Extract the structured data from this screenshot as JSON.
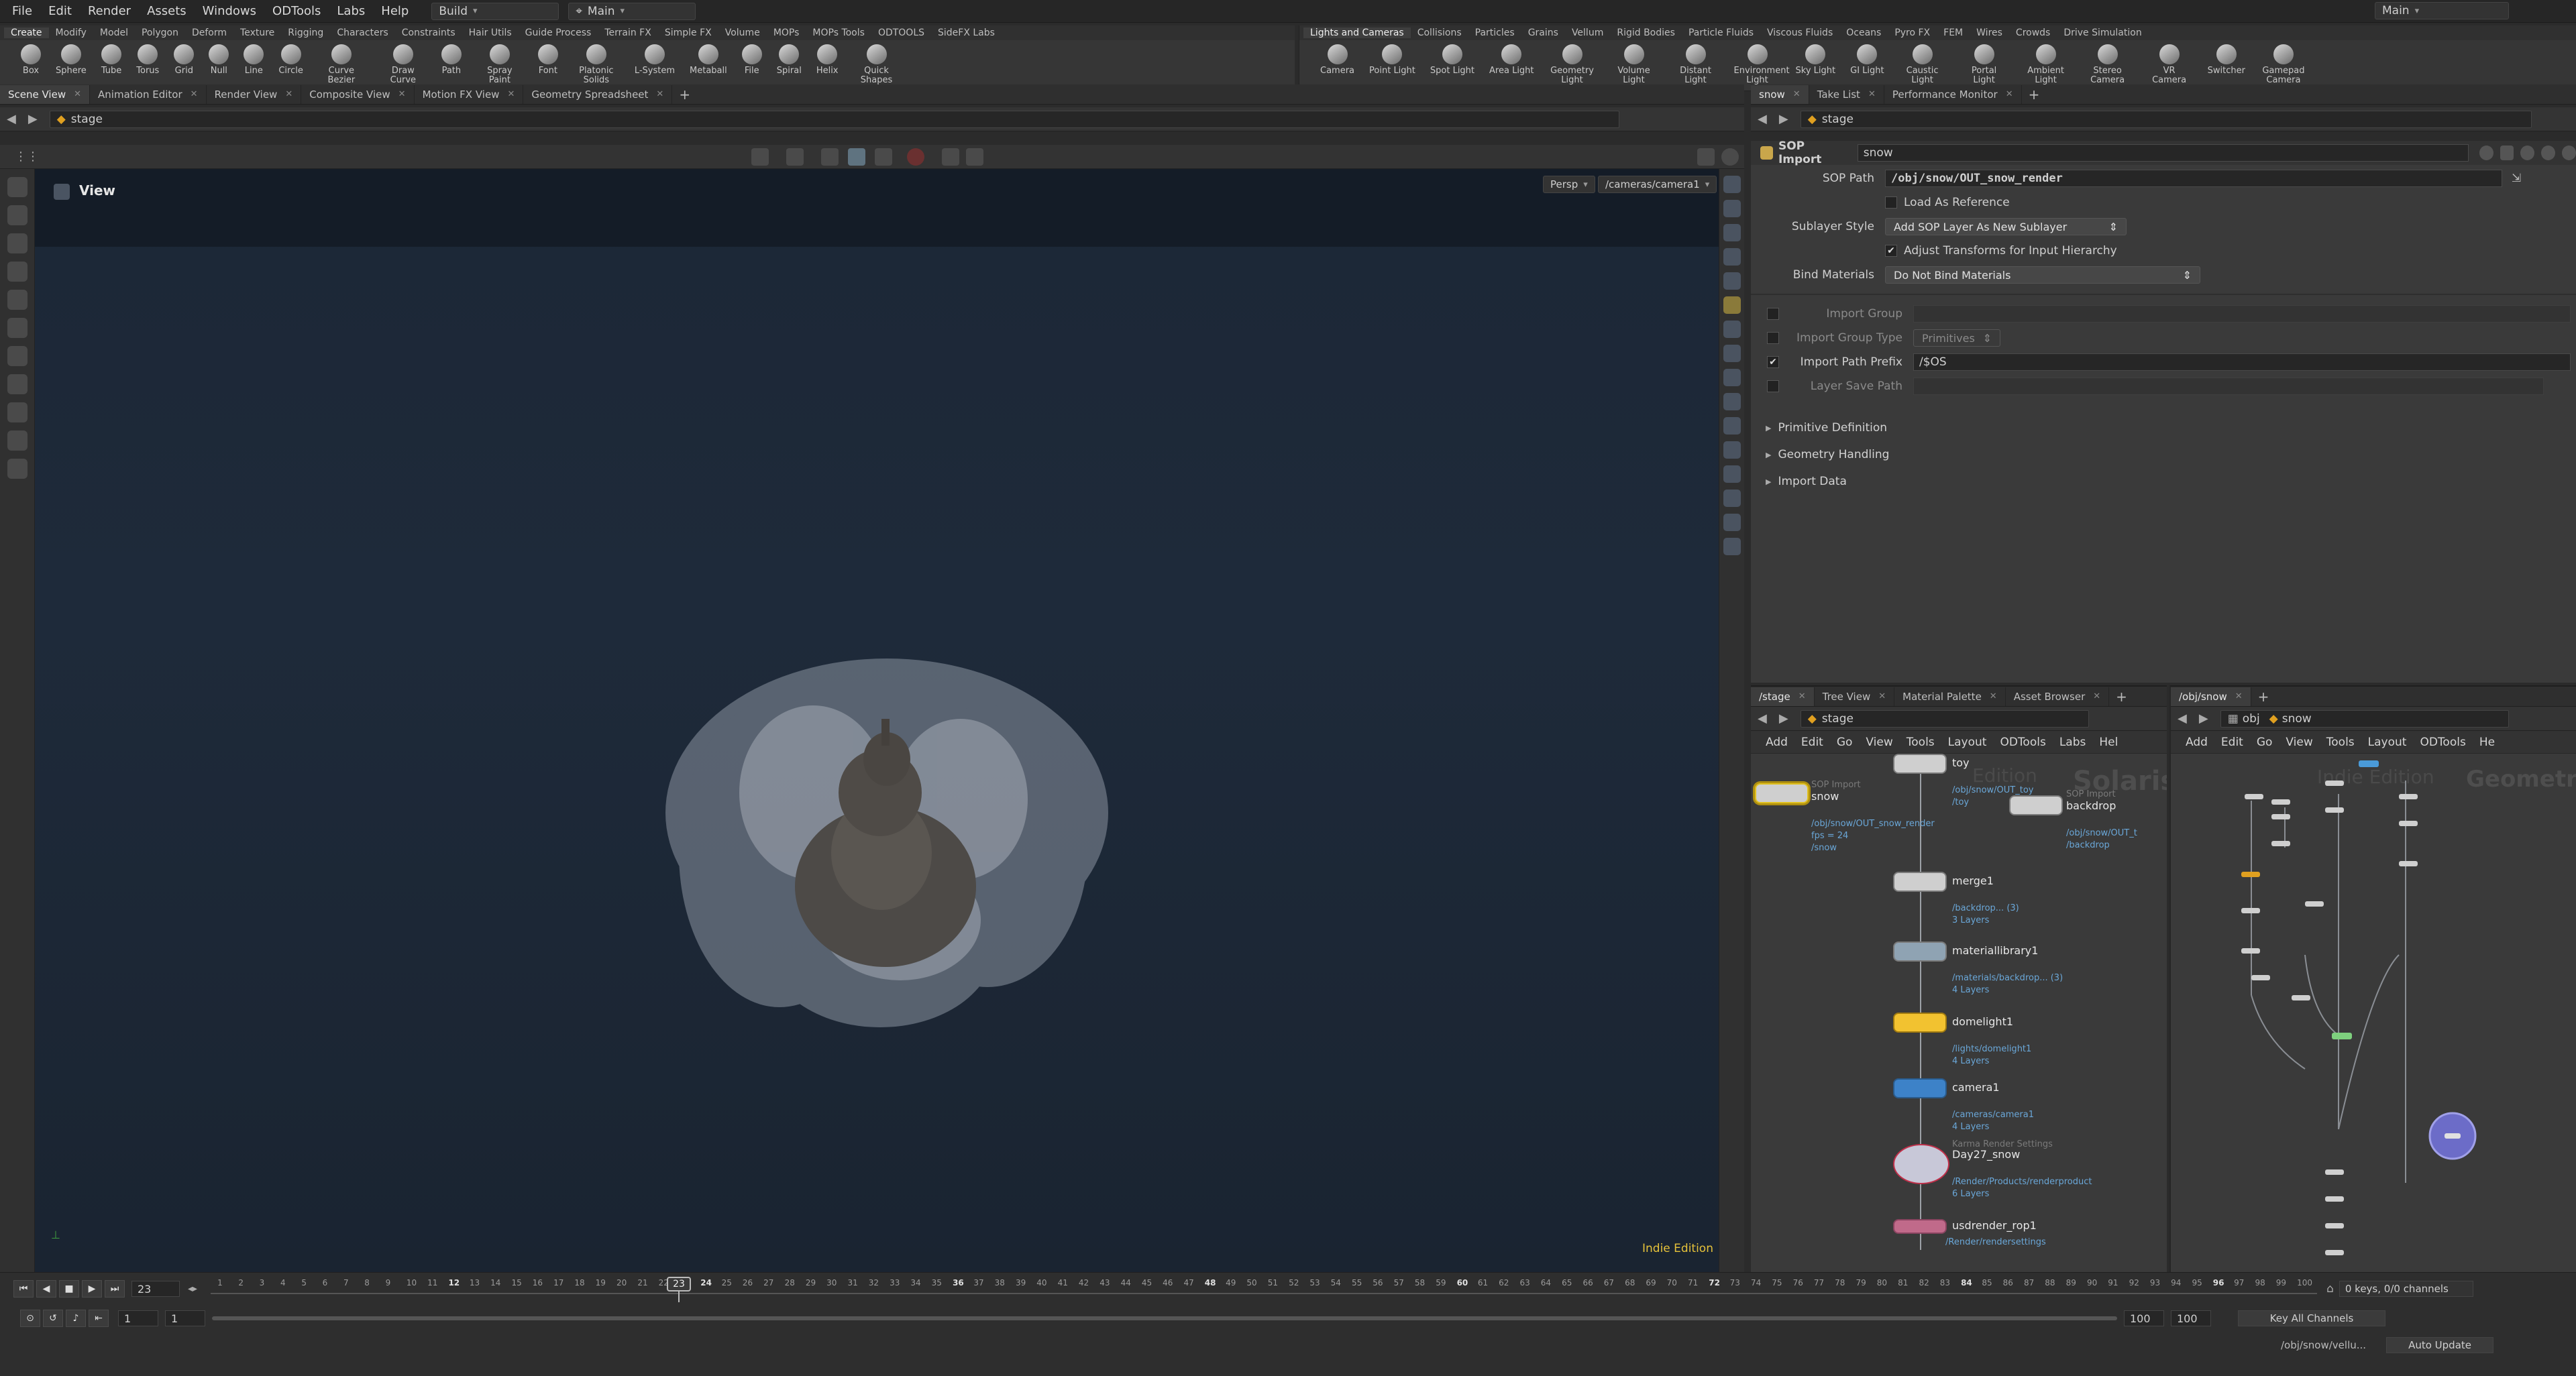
{
  "menubar": {
    "items": [
      "File",
      "Edit",
      "Render",
      "Assets",
      "Windows",
      "ODTools",
      "Labs",
      "Help"
    ],
    "desktop_dropdown": "Build",
    "context_dropdown": "Main",
    "right_dropdown": "Main"
  },
  "shelf_left": {
    "tabs": [
      "Create",
      "Modify",
      "Model",
      "Polygon",
      "Deform",
      "Texture",
      "Rigging",
      "Characters",
      "Constraints",
      "Hair Utils",
      "Guide Process",
      "Terrain FX",
      "Simple FX",
      "Volume",
      "MOPs",
      "MOPs Tools",
      "ODTOOLS",
      "SideFX Labs"
    ],
    "active_tab": "Create",
    "tools": [
      {
        "label": "Box",
        "icon": "box-icon"
      },
      {
        "label": "Sphere",
        "icon": "sphere-icon"
      },
      {
        "label": "Tube",
        "icon": "tube-icon"
      },
      {
        "label": "Torus",
        "icon": "torus-icon"
      },
      {
        "label": "Grid",
        "icon": "grid-icon"
      },
      {
        "label": "Null",
        "icon": "null-icon"
      },
      {
        "label": "Line",
        "icon": "line-icon"
      },
      {
        "label": "Circle",
        "icon": "circle-icon"
      },
      {
        "label": "Curve Bezier",
        "icon": "curve-bezier-icon"
      },
      {
        "label": "Draw Curve",
        "icon": "draw-curve-icon"
      },
      {
        "label": "Path",
        "icon": "path-icon"
      },
      {
        "label": "Spray Paint",
        "icon": "spray-paint-icon"
      },
      {
        "label": "Font",
        "icon": "font-icon"
      },
      {
        "label": "Platonic Solids",
        "icon": "platonic-solids-icon"
      },
      {
        "label": "L-System",
        "icon": "l-system-icon"
      },
      {
        "label": "Metaball",
        "icon": "metaball-icon"
      },
      {
        "label": "File",
        "icon": "file-icon"
      },
      {
        "label": "Spiral",
        "icon": "spiral-icon"
      },
      {
        "label": "Helix",
        "icon": "helix-icon"
      },
      {
        "label": "Quick Shapes",
        "icon": "quick-shapes-icon"
      }
    ]
  },
  "shelf_right": {
    "tabs": [
      "Lights and Cameras",
      "Collisions",
      "Particles",
      "Grains",
      "Vellum",
      "Rigid Bodies",
      "Particle Fluids",
      "Viscous Fluids",
      "Oceans",
      "Pyro FX",
      "FEM",
      "Wires",
      "Crowds",
      "Drive Simulation"
    ],
    "active_tab": "Lights and Cameras",
    "tools": [
      {
        "label": "Camera",
        "icon": "camera-icon"
      },
      {
        "label": "Point Light",
        "icon": "point-light-icon"
      },
      {
        "label": "Spot Light",
        "icon": "spot-light-icon"
      },
      {
        "label": "Area Light",
        "icon": "area-light-icon"
      },
      {
        "label": "Geometry Light",
        "icon": "geometry-light-icon"
      },
      {
        "label": "Volume Light",
        "icon": "volume-light-icon"
      },
      {
        "label": "Distant Light",
        "icon": "distant-light-icon"
      },
      {
        "label": "Environment Light",
        "icon": "environment-light-icon"
      },
      {
        "label": "Sky Light",
        "icon": "sky-light-icon"
      },
      {
        "label": "GI Light",
        "icon": "gi-light-icon"
      },
      {
        "label": "Caustic Light",
        "icon": "caustic-light-icon"
      },
      {
        "label": "Portal Light",
        "icon": "portal-light-icon"
      },
      {
        "label": "Ambient Light",
        "icon": "ambient-light-icon"
      },
      {
        "label": "Stereo Camera",
        "icon": "stereo-camera-icon"
      },
      {
        "label": "VR Camera",
        "icon": "vr-camera-icon"
      },
      {
        "label": "Switcher",
        "icon": "switcher-icon"
      },
      {
        "label": "Gamepad Camera",
        "icon": "gamepad-camera-icon"
      }
    ]
  },
  "viewer_tabs": [
    "Scene View",
    "Animation Editor",
    "Render View",
    "Composite View",
    "Motion FX View",
    "Geometry Spreadsheet"
  ],
  "viewer": {
    "path": "stage",
    "title": "View",
    "persp": "Persp",
    "camera": "/cameras/camera1",
    "watermark": "Indie Edition"
  },
  "param_tabs": [
    "snow",
    "Take List",
    "Performance Monitor"
  ],
  "params": {
    "path": "stage",
    "node_type": "SOP Import",
    "node_name": "snow",
    "sop_path_label": "SOP Path",
    "sop_path": "/obj/snow/OUT_snow_render",
    "load_as_reference": "Load As Reference",
    "sublayer_style_label": "Sublayer Style",
    "sublayer_style": "Add SOP Layer As New Sublayer",
    "adjust_transforms": "Adjust Transforms for Input Hierarchy",
    "bind_materials_label": "Bind Materials",
    "bind_materials": "Do Not Bind Materials",
    "import_group_label": "Import Group",
    "import_group_type_label": "Import Group Type",
    "import_group_type": "Primitives",
    "import_path_prefix_label": "Import Path Prefix",
    "import_path_prefix": "/$OS",
    "layer_save_path_label": "Layer Save Path",
    "folders": [
      "Primitive Definition",
      "Geometry Handling",
      "Import Data"
    ]
  },
  "net_left": {
    "tabs": [
      "/stage",
      "Tree View",
      "Material Palette",
      "Asset Browser"
    ],
    "path": "stage",
    "menu": [
      "Add",
      "Edit",
      "Go",
      "View",
      "Tools",
      "Layout",
      "ODTools",
      "Labs",
      "Hel"
    ],
    "watermark_big": "Solaris",
    "watermark_small": "Edition",
    "nodes": {
      "toy": {
        "type": "SOP Import",
        "name": "toy",
        "info": [
          "/obj/snow/OUT_toy",
          "/toy"
        ]
      },
      "snow": {
        "type": "SOP Import",
        "name": "snow",
        "info": [
          "/obj/snow/OUT_snow_render",
          "fps = 24",
          "/snow"
        ]
      },
      "backdrop": {
        "type": "SOP Import",
        "name": "backdrop",
        "info": [
          "/obj/snow/OUT_t",
          "/backdrop"
        ]
      },
      "merge1": {
        "name": "merge1",
        "info": [
          "/backdrop... (3)",
          "3 Layers"
        ]
      },
      "materiallibrary1": {
        "name": "materiallibrary1",
        "info": [
          "/materials/backdrop... (3)",
          "4 Layers"
        ]
      },
      "domelight1": {
        "name": "domelight1",
        "info": [
          "/lights/domelight1",
          "4 Layers"
        ]
      },
      "camera1": {
        "name": "camera1",
        "info": [
          "/cameras/camera1",
          "4 Layers"
        ]
      },
      "day27": {
        "type": "Karma Render Settings",
        "name": "Day27_snow",
        "info": [
          "/Render/Products/renderproduct",
          "6 Layers"
        ]
      },
      "usdrender": {
        "name": "usdrender_rop1",
        "info": [
          "/Render/rendersettings"
        ]
      }
    }
  },
  "net_right": {
    "tabs": [
      "/obj/snow"
    ],
    "path_root": "obj",
    "path": "snow",
    "menu": [
      "Add",
      "Edit",
      "Go",
      "View",
      "Tools",
      "Layout",
      "ODTools",
      "He"
    ],
    "watermark_big": "Geometry",
    "watermark_small": "Indie Edition"
  },
  "timeline": {
    "current_frame": "23",
    "start_frame": "1",
    "range_start": "1",
    "range_end": "100",
    "end_frame": "100",
    "ticks": [
      "1",
      "2",
      "3",
      "4",
      "5",
      "6",
      "7",
      "8",
      "9",
      "10",
      "11",
      "12",
      "13",
      "14",
      "15",
      "16",
      "17",
      "18",
      "19",
      "20",
      "21",
      "22",
      "24",
      "25",
      "26",
      "27",
      "28",
      "29",
      "30",
      "31",
      "32",
      "33",
      "34",
      "35",
      "36",
      "37",
      "38",
      "39",
      "40",
      "41",
      "42",
      "43",
      "44",
      "45",
      "46",
      "47",
      "48",
      "49",
      "50",
      "51",
      "52",
      "53",
      "54",
      "55",
      "56",
      "57",
      "58",
      "59",
      "60",
      "61",
      "62",
      "63",
      "64",
      "65",
      "66",
      "67",
      "68",
      "69",
      "70",
      "71",
      "72",
      "73",
      "74",
      "75",
      "76",
      "77",
      "78",
      "79",
      "80",
      "81",
      "82",
      "83",
      "84",
      "85",
      "86",
      "87",
      "88",
      "89",
      "90",
      "91",
      "92",
      "93",
      "94",
      "95",
      "96",
      "97",
      "98",
      "99",
      "100"
    ],
    "keys_info": "0 keys, 0/0 channels",
    "key_all": "Key All Channels",
    "status_path": "/obj/snow/vellu...",
    "update_mode": "Auto Update"
  },
  "colors": {
    "accent_orange": "#e0a020",
    "info_blue": "#6aa7d8",
    "viewport_bg": "#1e2a3a"
  }
}
